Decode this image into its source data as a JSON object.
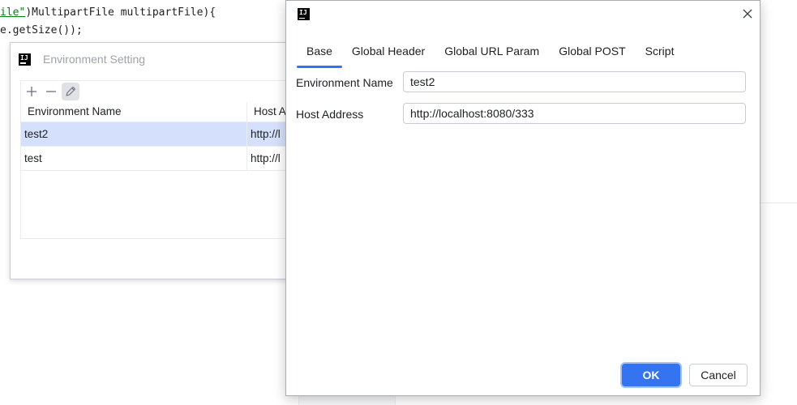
{
  "editor": {
    "line1_str": "ile\"",
    "line1_rest": ")MultipartFile multipartFile){",
    "line2": "e.getSize());"
  },
  "env_window": {
    "title": "Environment Setting",
    "toolbar": {
      "add": "+",
      "remove": "—"
    },
    "columns": [
      "Environment Name",
      "Host A"
    ],
    "rows": [
      {
        "name": "test2",
        "host": "http://l",
        "selected": true
      },
      {
        "name": "test",
        "host": "http://l",
        "selected": false
      }
    ]
  },
  "dialog": {
    "logo_text": "IJ",
    "tabs": [
      "Base",
      "Global Header",
      "Global URL Param",
      "Global POST",
      "Script"
    ],
    "active_tab": "Base",
    "fields": {
      "env_name_label": "Environment Name",
      "env_name_value": "test2",
      "host_label": "Host Address",
      "host_value": "http://localhost:8080/333"
    },
    "buttons": {
      "ok": "OK",
      "cancel": "Cancel"
    }
  },
  "colors": {
    "accent": "#3574f0",
    "selection": "#d5e1fc",
    "string_green": "#067d17"
  },
  "icons": {
    "app": "intellij-logo-icon",
    "close": "close-icon",
    "add": "plus-icon",
    "remove": "minus-icon",
    "edit": "pencil-icon"
  }
}
